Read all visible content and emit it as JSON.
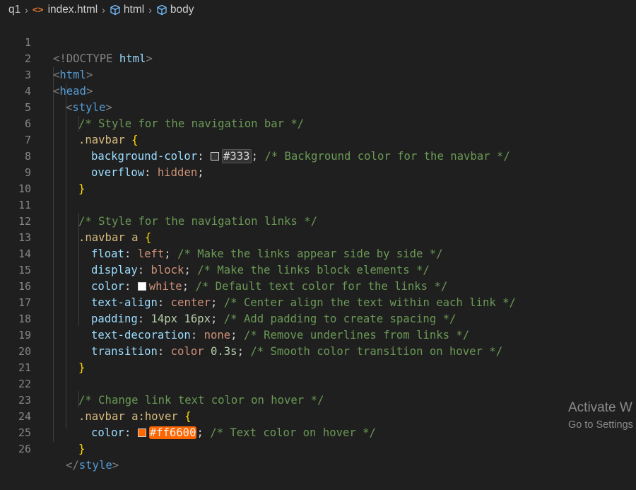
{
  "breadcrumb": {
    "folder": "q1",
    "file": "index.html",
    "html_node": "html",
    "body_node": "body"
  },
  "colors": {
    "background": "#1f1f1f",
    "tag": "#569cd6",
    "selector": "#d7ba7d",
    "property": "#9cdcfe",
    "value": "#ce9178",
    "number": "#b5cea8",
    "comment": "#6a9955",
    "brace": "#ffd700",
    "hover_highlight": "#ff6600"
  },
  "editor": {
    "lines": [
      {
        "n": "1",
        "doctype_open": "<!DOCTYPE ",
        "doctype_name": "html",
        "doctype_close": ">"
      },
      {
        "n": "2",
        "tag": "html"
      },
      {
        "n": "3",
        "tag": "head"
      },
      {
        "n": "4",
        "tag": "style"
      },
      {
        "n": "5",
        "comment": "/* Style for the navigation bar */"
      },
      {
        "n": "6",
        "selector": ".navbar",
        "brace": "{"
      },
      {
        "n": "7",
        "prop": "background-color",
        "value": "#333",
        "comment": "/* Background color for the navbar */"
      },
      {
        "n": "8",
        "prop": "overflow",
        "value": "hidden"
      },
      {
        "n": "9",
        "brace": "}"
      },
      {
        "n": "10"
      },
      {
        "n": "11",
        "comment": "/* Style for the navigation links */"
      },
      {
        "n": "12",
        "selector": ".navbar a",
        "brace": "{"
      },
      {
        "n": "13",
        "prop": "float",
        "value": "left",
        "comment": "/* Make the links appear side by side */"
      },
      {
        "n": "14",
        "prop": "display",
        "value": "block",
        "comment": "/* Make the links block elements */"
      },
      {
        "n": "15",
        "prop": "color",
        "value": "white",
        "comment": "/* Default text color for the links */"
      },
      {
        "n": "16",
        "prop": "text-align",
        "value": "center",
        "comment": "/* Center align the text within each link */"
      },
      {
        "n": "17",
        "prop": "padding",
        "value": "14px 16px",
        "comment": "/* Add padding to create spacing */"
      },
      {
        "n": "18",
        "prop": "text-decoration",
        "value": "none",
        "comment": "/* Remove underlines from links */"
      },
      {
        "n": "19",
        "prop": "transition",
        "value_kw": "color",
        "value_num": "0.3s",
        "comment": "/* Smooth color transition on hover */"
      },
      {
        "n": "20",
        "brace": "}"
      },
      {
        "n": "21"
      },
      {
        "n": "22",
        "comment": "/* Change link text color on hover */"
      },
      {
        "n": "23",
        "selector": ".navbar a:hover",
        "brace": "{"
      },
      {
        "n": "24",
        "prop": "color",
        "value": "#ff6600",
        "comment": "/* Text color on hover */"
      },
      {
        "n": "25",
        "brace": "}"
      },
      {
        "n": "26",
        "tag": "style"
      }
    ]
  },
  "watermark": {
    "line1": "Activate W",
    "line2": "Go to Settings"
  }
}
